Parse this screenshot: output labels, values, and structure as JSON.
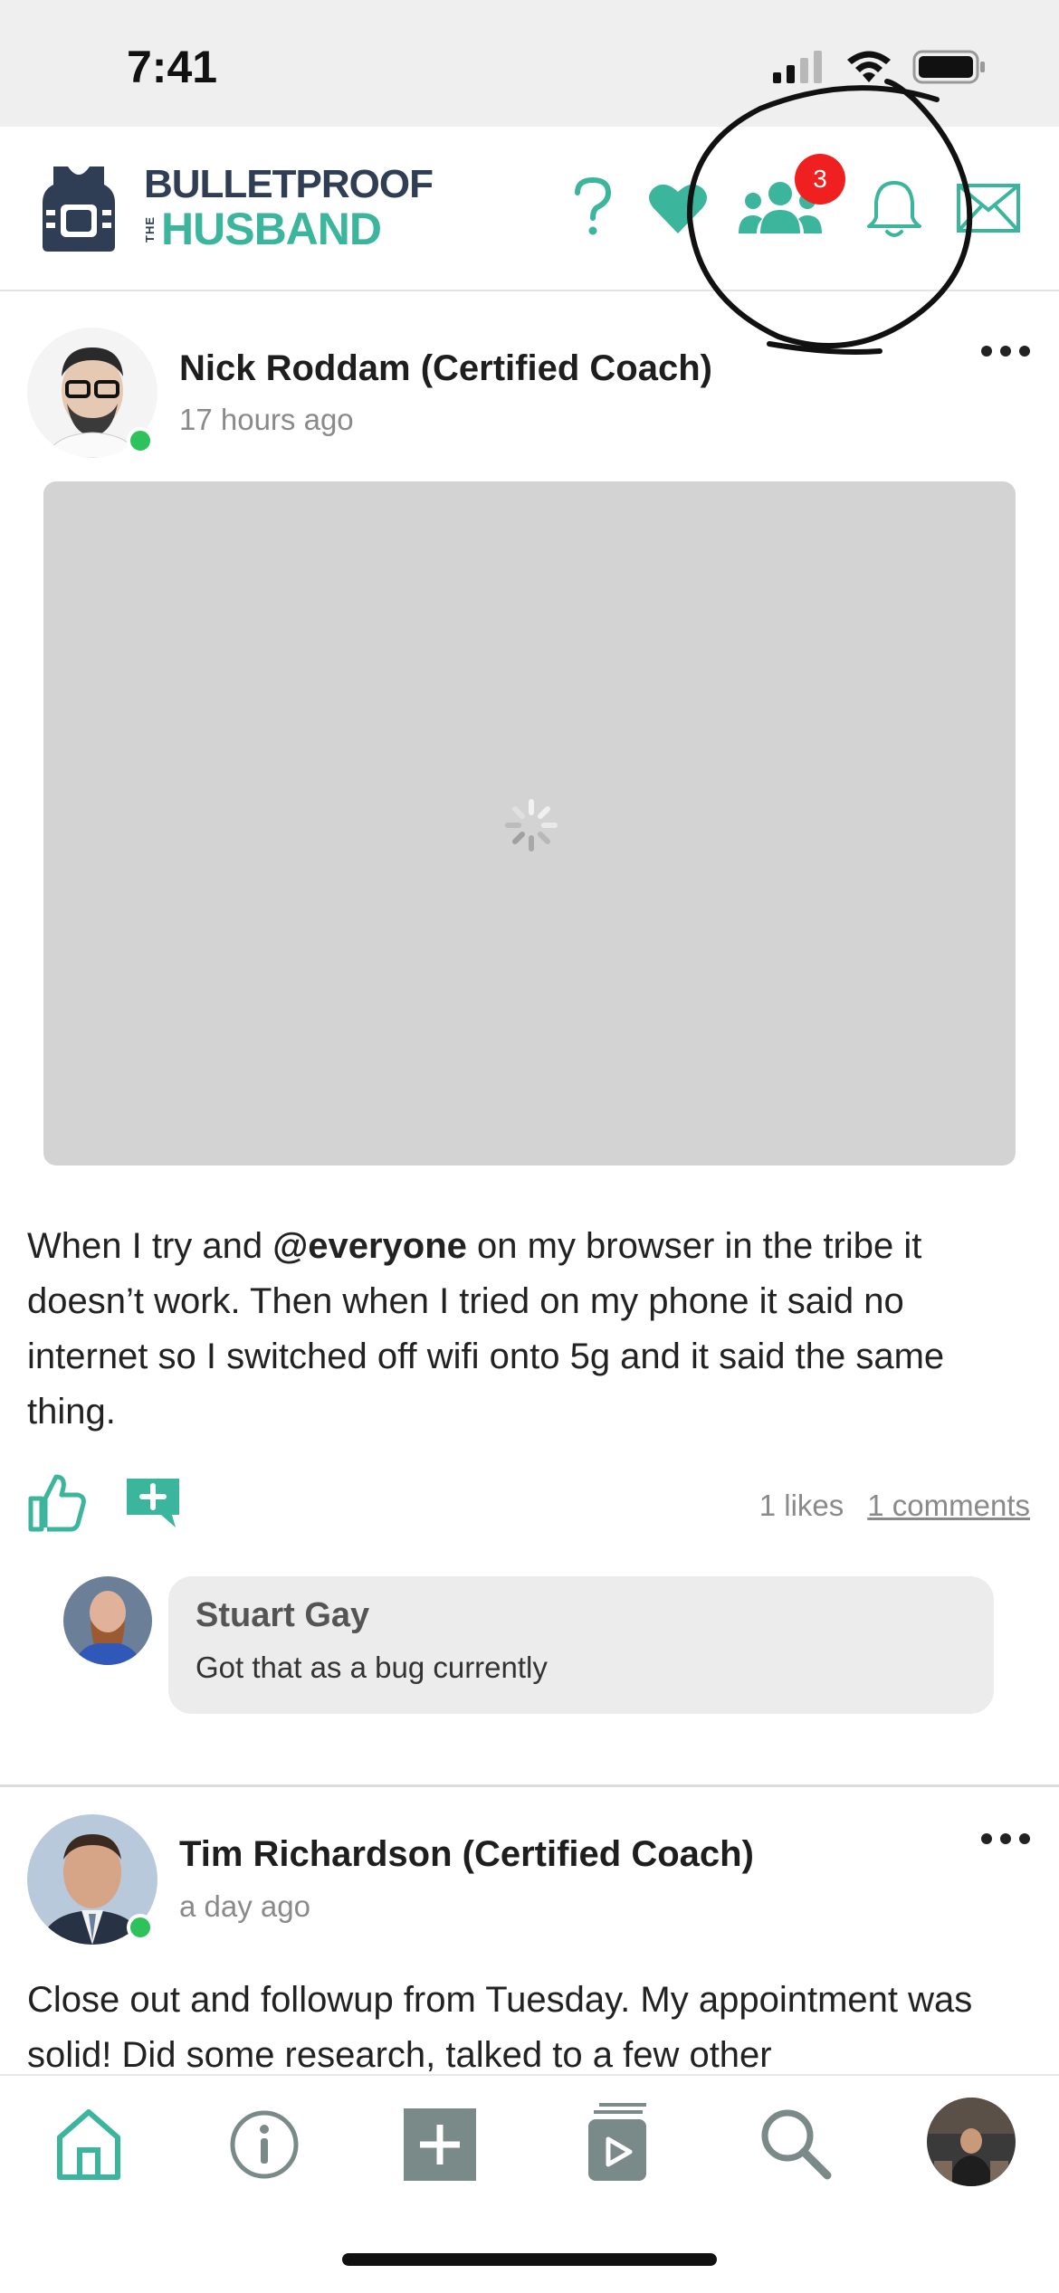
{
  "status_bar": {
    "time": "7:41"
  },
  "header": {
    "logo_top": "BULLETPROOF",
    "logo_the": "THE",
    "logo_bottom": "HUSBAND",
    "groups_badge_count": "3",
    "accent_color": "#3bb59b"
  },
  "posts": [
    {
      "author": "Nick Roddam (Certified Coach)",
      "time_ago": "17 hours ago",
      "text_before": "When I try and ",
      "mention": "@everyone",
      "text_after": " on my browser in the tribe it doesn’t work.  Then when I tried on my phone it said no internet so I switched off wifi onto 5g and it said the same thing.",
      "likes": "1 likes",
      "comments": "1 comments",
      "comment": {
        "author": "Stuart Gay",
        "text": "Got that as a bug currently"
      }
    },
    {
      "author": "Tim Richardson (Certified Coach)",
      "time_ago": "a day ago",
      "text": "Close out and followup from Tuesday. My appointment was solid! Did some research, talked to a few other"
    }
  ],
  "icons": {
    "header": [
      "help-icon",
      "heart-icon",
      "groups-icon",
      "bell-icon",
      "mail-icon"
    ],
    "bottom_nav": [
      "home-icon",
      "info-icon",
      "add-icon",
      "course-icon",
      "search-icon",
      "profile-avatar"
    ]
  }
}
